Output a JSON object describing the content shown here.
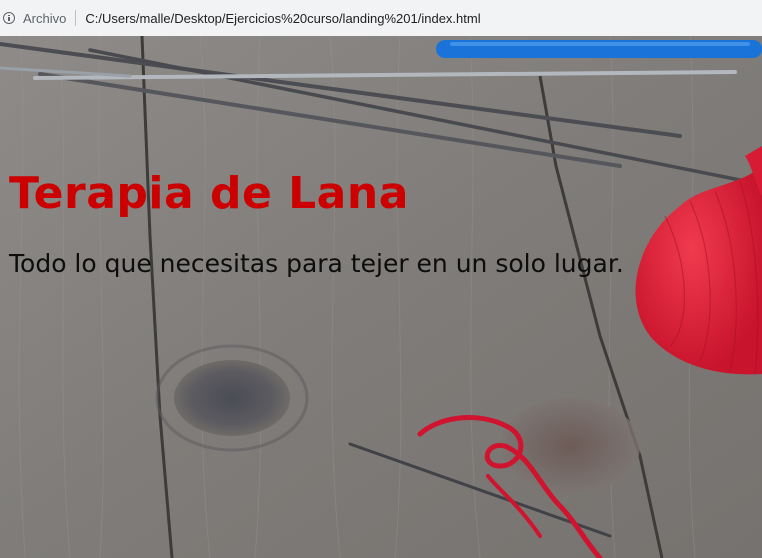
{
  "browser": {
    "security_label": "Archivo",
    "url": "C:/Users/malle/Desktop/Ejercicios%20curso/landing%201/index.html"
  },
  "hero": {
    "title": "Terapia de Lana",
    "subtitle": "Todo lo que necesitas para tejer en un solo lugar."
  },
  "colors": {
    "title": "#cc0000",
    "subtitle": "#0d0d0d",
    "wood": "#8a8784",
    "heart_yarn": "#e0223a",
    "crochet_hook": "#1a73d9"
  },
  "icons": [
    "info-icon",
    "knitting-needles",
    "crochet-hook",
    "yarn-heart",
    "red-yarn-strand"
  ]
}
